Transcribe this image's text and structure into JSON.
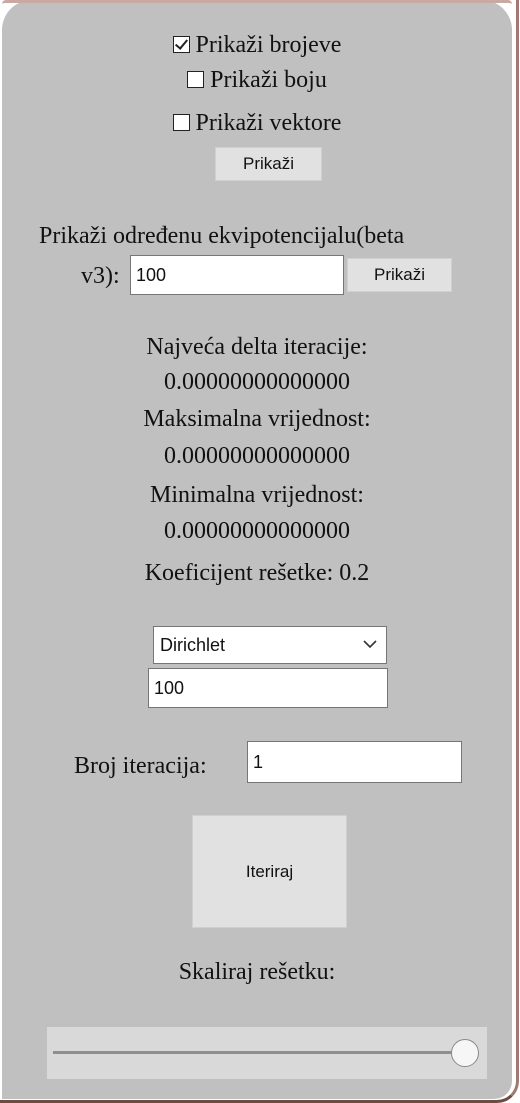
{
  "options": [
    {
      "label": "Prikaži brojeve",
      "checked": true
    },
    {
      "label": "Prikaži boju",
      "checked": false
    },
    {
      "label": "Prikaži vektore",
      "checked": false
    }
  ],
  "show_button": "Prikaži",
  "equipotential": {
    "label_line1": "Prikaži određenu ekvipotencijalu(beta",
    "label_line2": "v3):",
    "value": "100",
    "button": "Prikaži"
  },
  "stats": {
    "max_delta_label": "Najveća delta iteracije:",
    "max_delta_value": "0.00000000000000",
    "max_value_label": "Maksimalna vrijednost:",
    "max_value_value": "0.00000000000000",
    "min_value_label": "Minimalna vrijednost:",
    "min_value_value": "0.00000000000000",
    "grid_coef_label": "Koeficijent rešetke: 0.2"
  },
  "boundary": {
    "selected": "Dirichlet",
    "value": "100"
  },
  "iterations": {
    "label": "Broj iteracija:",
    "value": "1"
  },
  "iterate_button": "Iteriraj",
  "scale": {
    "label": "Skaliraj rešetku:",
    "level": 1.0
  }
}
